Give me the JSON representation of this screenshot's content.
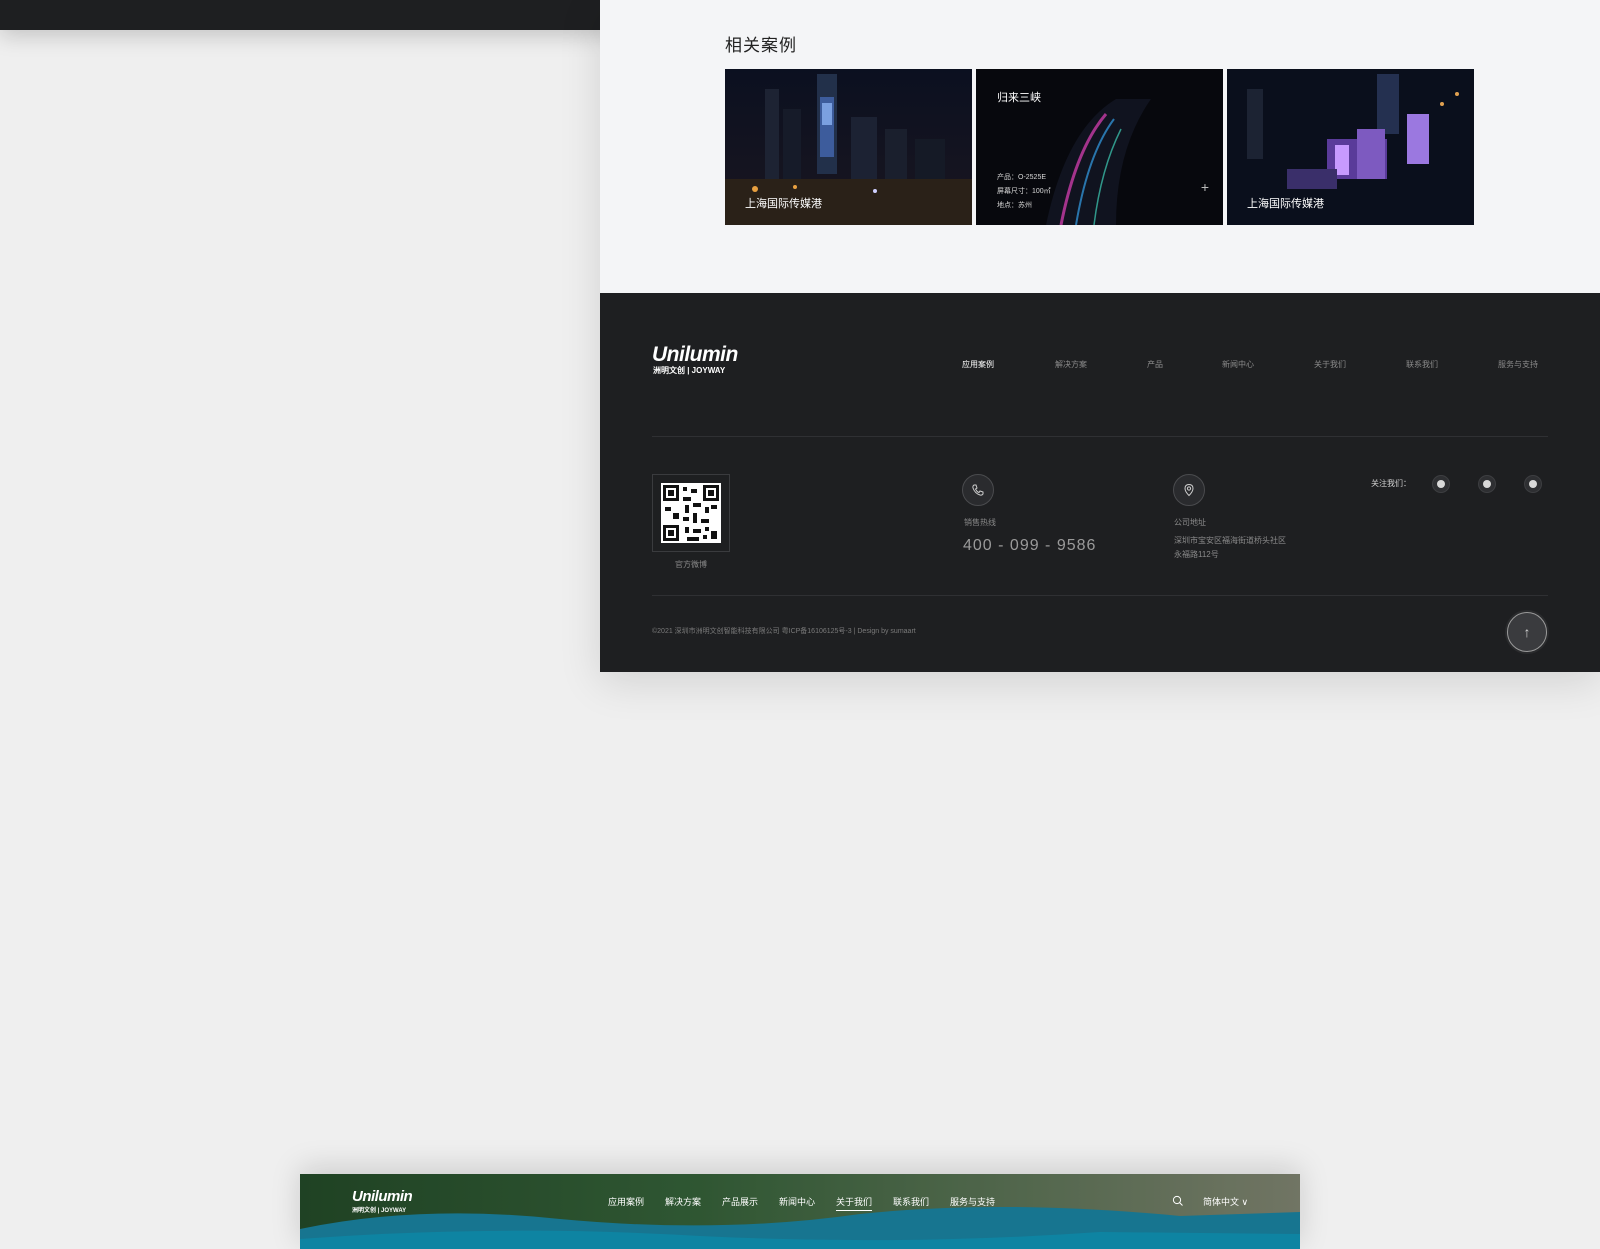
{
  "related": {
    "title": "相关案例",
    "cards": [
      {
        "label": "上海国际传媒港"
      },
      {
        "hover_title": "归来三峡",
        "product": "产品：O-2525E",
        "size": "屏幕尺寸：100㎡",
        "location": "地点：苏州",
        "plus": "+"
      },
      {
        "label": "上海国际传媒港"
      }
    ]
  },
  "footer": {
    "logo": {
      "main": "Unilumin",
      "sub": "洲明文创 | JOYWAY"
    },
    "nav": [
      "应用案例",
      "解决方案",
      "产品",
      "新闻中心",
      "关于我们",
      "联系我们",
      "服务与支持"
    ],
    "qr_caption": "官方微博",
    "sales_label": "销售热线",
    "phone": "400 - 099 - 9586",
    "address_label": "公司地址",
    "address_line1": "深圳市宝安区福海街道桥头社区",
    "address_line2": "永福路112号",
    "follow_label": "关注我们：",
    "social_icons": [
      "wechat-icon",
      "qq-icon",
      "weibo-icon"
    ],
    "copyright": "©2021 深圳市洲明文创智能科技有限公司 粤ICP备16106125号-3 | Design by sumaart",
    "back_to_top": "↑"
  },
  "header_preview": {
    "logo": {
      "main": "Unilumin",
      "sub": "洲明文创 | JOYWAY"
    },
    "nav": [
      "应用案例",
      "解决方案",
      "产品展示",
      "新闻中心",
      "关于我们",
      "联系我们",
      "服务与支持"
    ],
    "active_index": 4,
    "language": "简体中文 ∨"
  }
}
